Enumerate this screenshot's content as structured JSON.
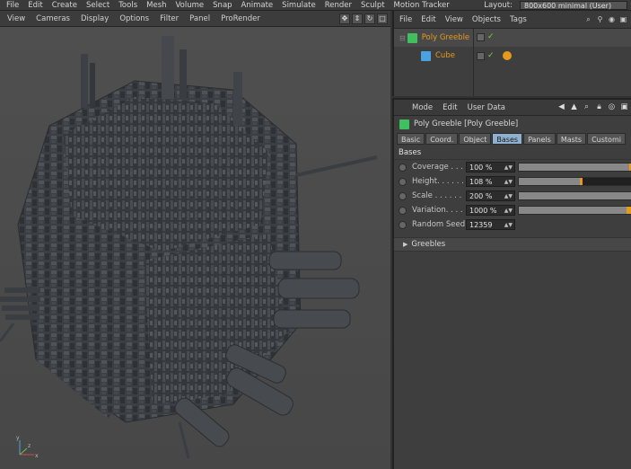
{
  "menubar": {
    "items": [
      "File",
      "Edit",
      "Create",
      "Select",
      "Tools",
      "Mesh",
      "Volume",
      "Snap",
      "Animate",
      "Simulate",
      "Render",
      "Sculpt",
      "Motion Tracker"
    ],
    "layout_label": "Layout:",
    "layout_value": "800x600 minimal (User)"
  },
  "viewport": {
    "menus": [
      "View",
      "Cameras",
      "Display",
      "Options",
      "Filter",
      "Panel",
      "ProRender"
    ],
    "axis": {
      "x": "x",
      "y": "y",
      "z": "z"
    }
  },
  "object_manager": {
    "menus": [
      "File",
      "Edit",
      "View",
      "Objects",
      "Tags"
    ],
    "objects": [
      {
        "name": "Poly Greeble",
        "color": "#e59a1e",
        "icon": "poly-greeble-icon",
        "selected": true
      },
      {
        "name": "Cube",
        "color": "#e59a1e",
        "icon": "cube-icon",
        "selected": false
      }
    ]
  },
  "attribute_manager": {
    "menus": [
      "Mode",
      "Edit",
      "User Data"
    ],
    "title": "Poly Greeble [Poly Greeble]",
    "tabs": [
      "Basic",
      "Coord.",
      "Object",
      "Bases",
      "Panels",
      "Masts",
      "Customi"
    ],
    "active_tab": "Bases",
    "section": "Bases",
    "params": [
      {
        "label": "Coverage . . .",
        "value": "100 %",
        "fraction": 1.0
      },
      {
        "label": "Height. . . . . .",
        "value": "108 %",
        "fraction": 0.54
      },
      {
        "label": "Scale . . . . . .",
        "value": "200 %",
        "fraction": 1.0
      },
      {
        "label": "Variation. . . .",
        "value": "1000 %",
        "fraction": 1.0
      },
      {
        "label": "Random Seed",
        "value": "12359",
        "fraction": null
      }
    ],
    "greebles_label": "Greebles"
  },
  "colors": {
    "accent_orange": "#e59a1e",
    "active_tab": "#8fb0cf",
    "check_green": "#7bd23c",
    "greeble_icon": "#3fbf5f",
    "cube_icon": "#4aa3e0"
  }
}
